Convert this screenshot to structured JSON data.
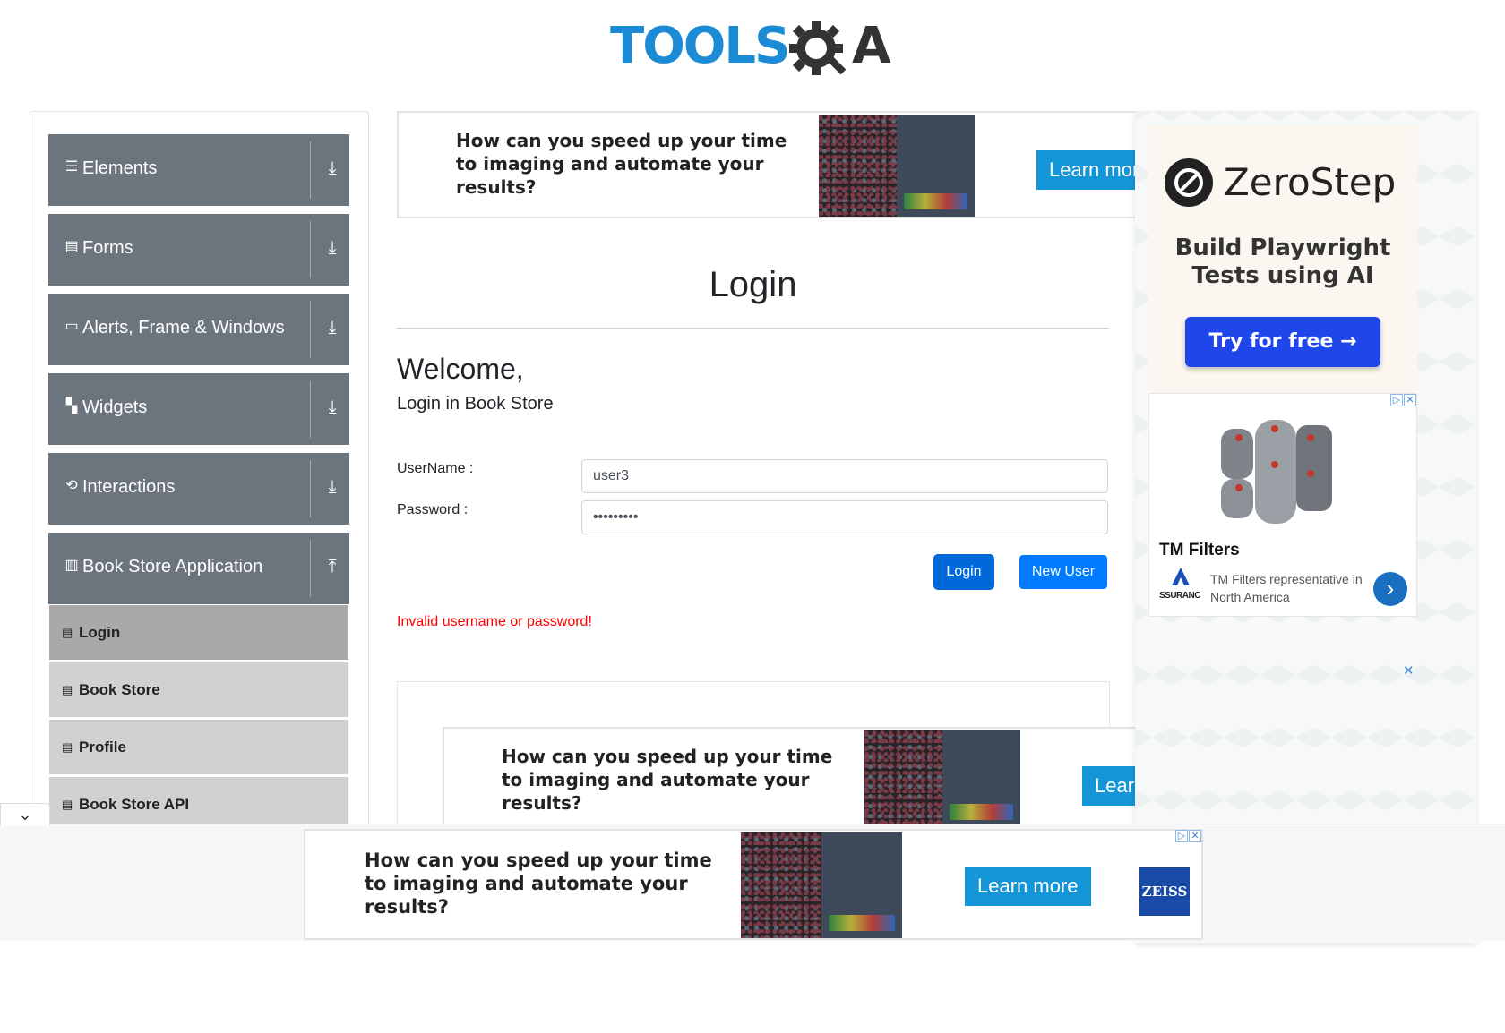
{
  "header": {
    "logo_text_left": "TOOLS",
    "logo_text_right": "A"
  },
  "sidebar": {
    "groups": [
      {
        "label": "Elements",
        "icon": "list-icon",
        "expanded": false
      },
      {
        "label": "Forms",
        "icon": "document-icon",
        "expanded": false
      },
      {
        "label": "Alerts, Frame & Windows",
        "icon": "window-icon",
        "expanded": false
      },
      {
        "label": "Widgets",
        "icon": "widgets-icon",
        "expanded": false
      },
      {
        "label": "Interactions",
        "icon": "interaction-icon",
        "expanded": false
      },
      {
        "label": "Book Store Application",
        "icon": "books-icon",
        "expanded": true
      }
    ],
    "book_store_items": [
      {
        "label": "Login",
        "active": true
      },
      {
        "label": "Book Store",
        "active": false
      },
      {
        "label": "Profile",
        "active": false
      },
      {
        "label": "Book Store API",
        "active": false
      }
    ],
    "colors": {
      "group_bg": "#6c757d",
      "item_bg": "#d1d1d1",
      "item_active_bg": "#a9a9a9"
    }
  },
  "ads": {
    "question": "How can you speed up your time to imaging and automate your results?",
    "cta": "Learn more",
    "cta_top_visible": "Learn more",
    "cta_lower_visible": "Learn",
    "brand_badge": "ZEISS"
  },
  "main": {
    "title": "Login",
    "welcome": "Welcome,",
    "subtitle": "Login in Book Store",
    "username_label": "UserName :",
    "password_label": "Password :",
    "username_value": "user3",
    "password_value": "•••••••••",
    "login_button": "Login",
    "new_user_button": "New User",
    "error": "Invalid username or password!",
    "colors": {
      "primary": "#007bff",
      "login_btn": "#0069d9",
      "error": "#ff0000"
    }
  },
  "right_ads": {
    "zerostep_name": "ZeroStep",
    "zerostep_tagline": "Build Playwright Tests using AI",
    "zerostep_cta": "Try for free →",
    "tm_title": "TM Filters",
    "tm_desc": "TM Filters representative in North America",
    "tm_brand": "SSURANC",
    "adchoices": "▷",
    "close": "✕"
  },
  "bottom_bar": {
    "collapse_icon": "chevron-down-icon"
  }
}
